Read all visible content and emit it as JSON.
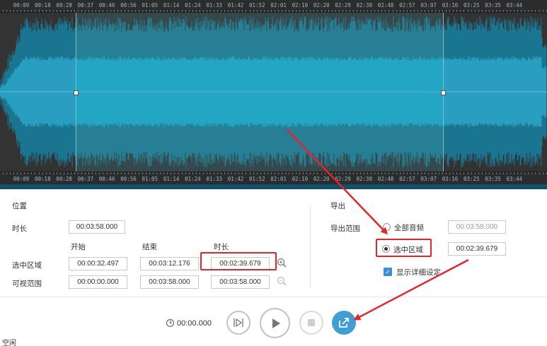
{
  "timeline": {
    "labels": [
      "00:09",
      "00:18",
      "00:28",
      "00:37",
      "00:46",
      "00:56",
      "01:05",
      "01:14",
      "01:24",
      "01:33",
      "01:42",
      "01:52",
      "02:01",
      "02:10",
      "02:20",
      "02:29",
      "02:38",
      "02:48",
      "02:57",
      "03:07",
      "03:16",
      "03:25",
      "03:35",
      "03:44"
    ]
  },
  "position": {
    "section_label": "位置",
    "duration_label": "时长",
    "duration_value": "00:03:58.000",
    "col_start": "开始",
    "col_end": "结束",
    "col_length": "时长",
    "selection_label": "选中区域",
    "selection_start": "00:00:32.497",
    "selection_end": "00:03:12.176",
    "selection_length": "00:02:39.679",
    "visible_label": "可视范围",
    "visible_start": "00:00:00.000",
    "visible_end": "00:03:58.000",
    "visible_length": "00:03:58.000"
  },
  "export": {
    "section_label": "导出",
    "range_label": "导出范围",
    "option_all": "全部音频",
    "option_all_value": "00:03:58.000",
    "option_selection": "选中区域",
    "option_selection_value": "00:02:39.679",
    "show_details": "显示详细设定"
  },
  "playback": {
    "time": "00:00.000"
  },
  "status": "空闲",
  "colors": {
    "wave_light": "#1ab5d8",
    "wave_dark": "#1a87a8",
    "annotation_red": "#e8242b",
    "export_button": "#3f9fd4"
  }
}
